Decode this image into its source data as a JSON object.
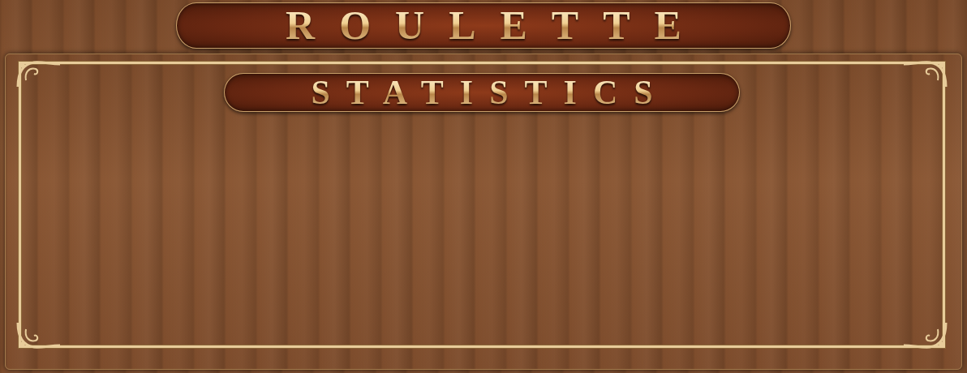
{
  "header": {
    "title": "ROULETTE"
  },
  "panel": {
    "title": "STATISTICS"
  }
}
